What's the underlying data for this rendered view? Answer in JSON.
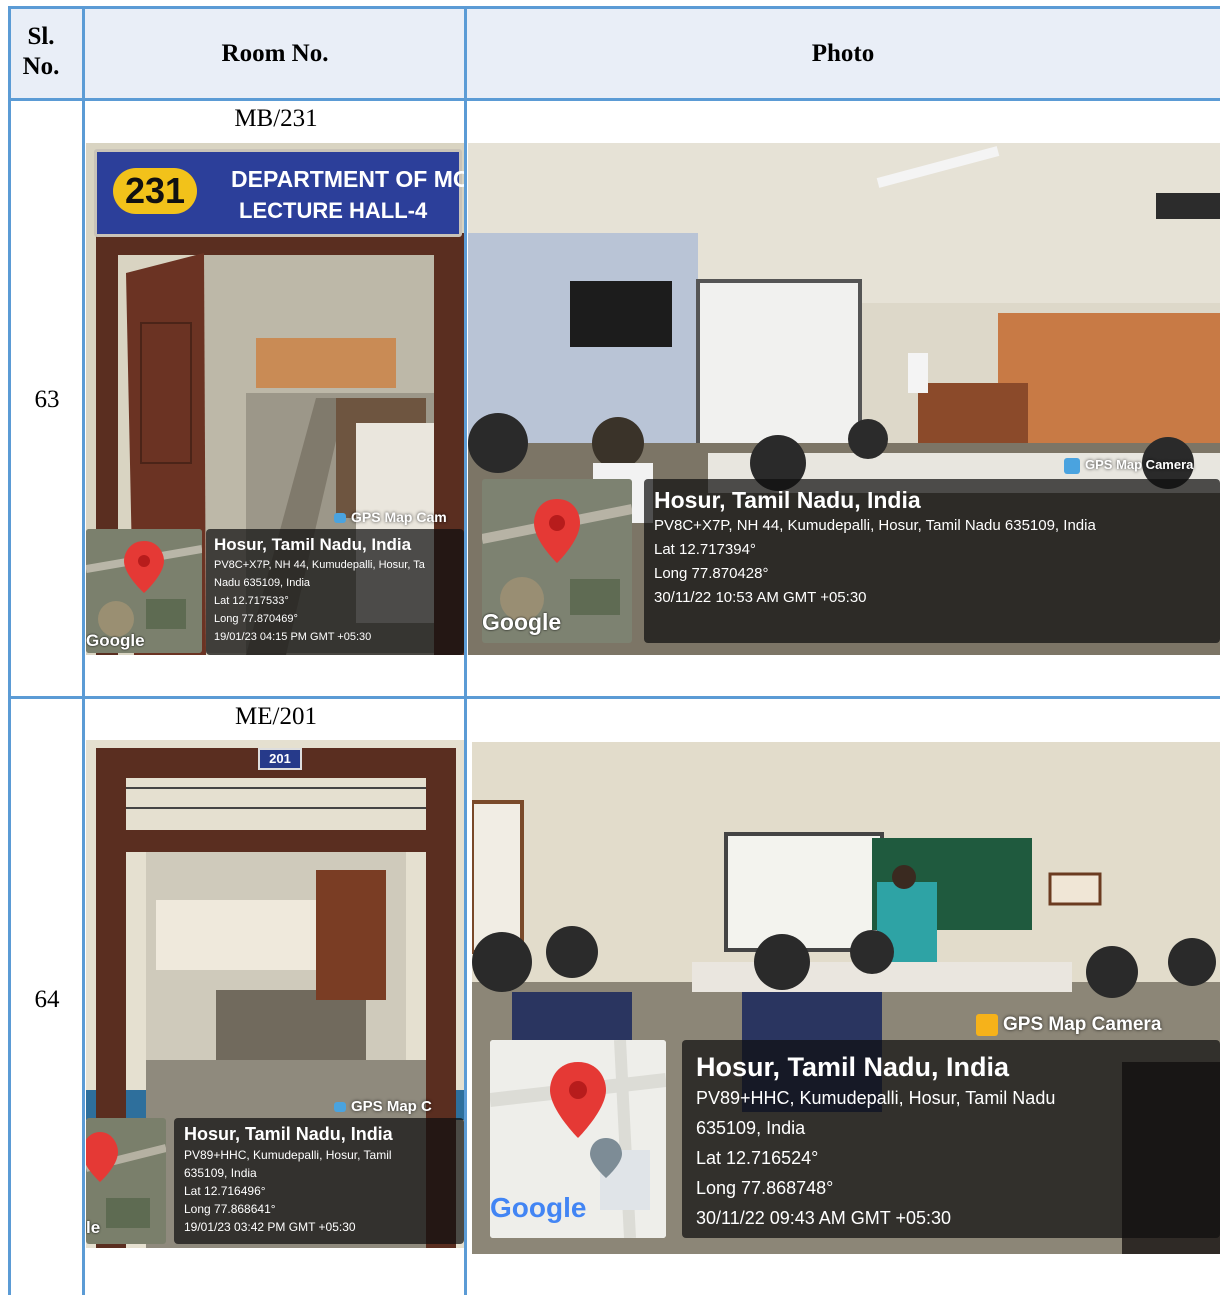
{
  "headers": {
    "sl_no": "Sl. No.",
    "room_no": "Room No.",
    "photo": "Photo"
  },
  "rows": [
    {
      "sl": "63",
      "room": "MB/231",
      "sign": {
        "number": "231",
        "line1": "DEPARTMENT OF MCA",
        "line2": "LECTURE HALL-4"
      },
      "room_photo": {
        "gps_label": "GPS Map Cam",
        "place": "Hosur, Tamil Nadu, India",
        "addr1": "PV8C+X7P, NH 44, Kumudepalli, Hosur, Ta",
        "addr2": "Nadu 635109, India",
        "lat": "Lat 12.717533°",
        "long": "Long 77.870469°",
        "time": "19/01/23 04:15 PM GMT +05:30",
        "google": "Google"
      },
      "class_photo": {
        "gps_label": "GPS Map Camera",
        "place": "Hosur, Tamil Nadu, India",
        "addr1": "PV8C+X7P, NH 44, Kumudepalli, Hosur, Tamil Nadu 635109, India",
        "lat": "Lat 12.717394°",
        "long": "Long 77.870428°",
        "time": "30/11/22 10:53 AM GMT +05:30",
        "google": "Google"
      }
    },
    {
      "sl": "64",
      "room": "ME/201",
      "sign": {
        "number": "201"
      },
      "room_photo": {
        "gps_label": "GPS Map C",
        "place": "Hosur, Tamil Nadu, India",
        "addr1": "PV89+HHC, Kumudepalli, Hosur, Tamil",
        "addr2": "635109, India",
        "lat": "Lat 12.716496°",
        "long": "Long 77.868641°",
        "time": "19/01/23 03:42 PM GMT +05:30",
        "google": "le"
      },
      "class_photo": {
        "gps_label": "GPS Map Camera",
        "place": "Hosur, Tamil Nadu, India",
        "addr1": "PV89+HHC, Kumudepalli, Hosur, Tamil Nadu",
        "addr2": "635109, India",
        "lat": "Lat 12.716524°",
        "long": "Long 77.868748°",
        "time": "30/11/22 09:43 AM GMT +05:30",
        "google": "Google"
      }
    }
  ]
}
